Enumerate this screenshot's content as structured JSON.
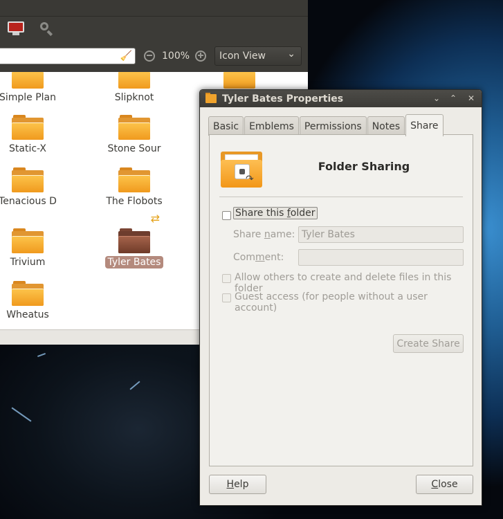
{
  "file_manager": {
    "zoom_level": "100%",
    "view_mode": "Icon View",
    "items": [
      {
        "name": "Simple Plan"
      },
      {
        "name": "Slipknot"
      },
      {
        "name": "Static-X"
      },
      {
        "name": "Stone Sour"
      },
      {
        "name": "Tenacious D"
      },
      {
        "name": "The Flobots"
      },
      {
        "name": "Trivium"
      },
      {
        "name": "Tyler Bates",
        "selected": true,
        "shared": true
      },
      {
        "name": "Wheatus"
      }
    ]
  },
  "dialog": {
    "title": "Tyler Bates Properties",
    "tabs": [
      {
        "label": "Basic"
      },
      {
        "label": "Emblems"
      },
      {
        "label": "Permissions"
      },
      {
        "label": "Notes"
      },
      {
        "label": "Share",
        "active": true
      }
    ],
    "heading": "Folder Sharing",
    "share_checkbox": {
      "label_pre": "Share this ",
      "label_u": "f",
      "label_post": "older",
      "checked": false
    },
    "share_name": {
      "label_pre": "Share ",
      "label_u": "n",
      "label_post": "ame:",
      "value": "Tyler Bates"
    },
    "comment": {
      "label_pre": "Com",
      "label_u": "m",
      "label_post": "ent:",
      "value": ""
    },
    "allow_others": {
      "label": "Allow others to create and delete files in this folder",
      "checked": false
    },
    "guest_access": {
      "label": "Guest access (for people without a user account)",
      "checked": false
    },
    "create_share_label": "Create Share",
    "help": {
      "u": "H",
      "rest": "elp"
    },
    "close": {
      "u": "C",
      "rest": "lose"
    }
  }
}
